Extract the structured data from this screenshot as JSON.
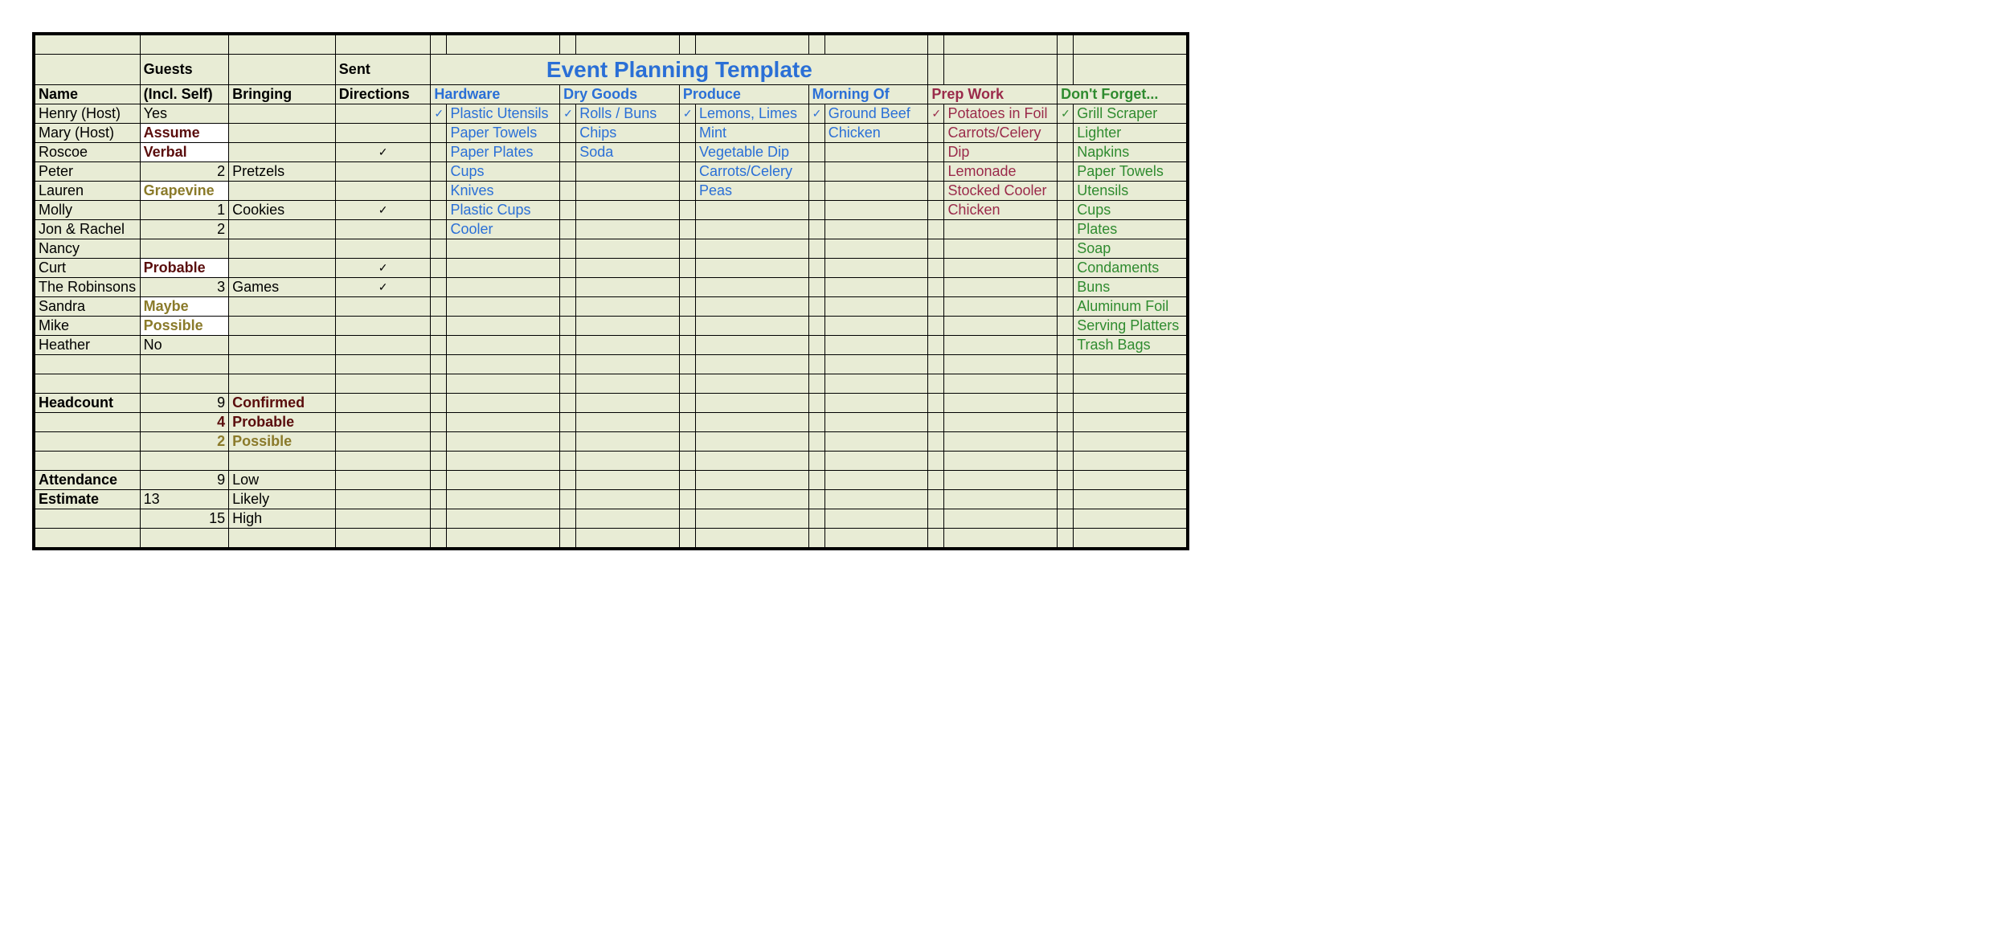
{
  "title": "Event Planning Template",
  "headers": {
    "guests": "Guests",
    "sent": "Sent",
    "name": "Name",
    "incl": "(Incl. Self)",
    "bringing": "Bringing",
    "directions": "Directions",
    "hardware": "Hardware",
    "drygoods": "Dry Goods",
    "produce": "Produce",
    "morning": "Morning Of",
    "prep": "Prep Work",
    "dontforget": "Don't Forget..."
  },
  "guests": [
    {
      "name": "Henry (Host)",
      "incl": "Yes",
      "bringing": "",
      "dir": ""
    },
    {
      "name": "Mary (Host)",
      "incl": "Assume",
      "inclClass": "txt-darkred white-bg",
      "bringing": "",
      "dir": ""
    },
    {
      "name": "Roscoe",
      "incl": "Verbal",
      "inclClass": "txt-darkred white-bg",
      "bringing": "",
      "dir": "✓"
    },
    {
      "name": "Peter",
      "incl": "2",
      "inclNum": true,
      "bringing": "Pretzels",
      "dir": ""
    },
    {
      "name": "Lauren",
      "incl": "Grapevine",
      "inclClass": "txt-olive white-bg",
      "bringing": "",
      "dir": ""
    },
    {
      "name": "Molly",
      "incl": "1",
      "inclNum": true,
      "bringing": "Cookies",
      "dir": "✓"
    },
    {
      "name": "Jon & Rachel",
      "incl": "2",
      "inclNum": true,
      "bringing": "",
      "dir": ""
    },
    {
      "name": "Nancy",
      "incl": "",
      "bringing": "",
      "dir": ""
    },
    {
      "name": "Curt",
      "incl": "Probable",
      "inclClass": "txt-darkred white-bg",
      "bringing": "",
      "dir": "✓"
    },
    {
      "name": "The Robinsons",
      "incl": "3",
      "inclNum": true,
      "bringing": "Games",
      "dir": "✓"
    },
    {
      "name": "Sandra",
      "incl": "Maybe",
      "inclClass": "txt-olive white-bg",
      "bringing": "",
      "dir": ""
    },
    {
      "name": "Mike",
      "incl": "Possible",
      "inclClass": "txt-olive white-bg",
      "bringing": "",
      "dir": ""
    },
    {
      "name": "Heather",
      "incl": "No",
      "bringing": "",
      "dir": ""
    }
  ],
  "hardware": [
    {
      "chk": "✓",
      "item": "Plastic Utensils"
    },
    {
      "chk": "",
      "item": "Paper Towels"
    },
    {
      "chk": "",
      "item": "Paper Plates"
    },
    {
      "chk": "",
      "item": "Cups"
    },
    {
      "chk": "",
      "item": "Knives"
    },
    {
      "chk": "",
      "item": "Plastic Cups"
    },
    {
      "chk": "",
      "item": "Cooler"
    }
  ],
  "drygoods": [
    {
      "chk": "✓",
      "item": "Rolls / Buns"
    },
    {
      "chk": "",
      "item": "Chips"
    },
    {
      "chk": "",
      "item": "Soda"
    }
  ],
  "produce": [
    {
      "chk": "✓",
      "item": "Lemons, Limes"
    },
    {
      "chk": "",
      "item": "Mint"
    },
    {
      "chk": "",
      "item": "Vegetable Dip"
    },
    {
      "chk": "",
      "item": "Carrots/Celery"
    },
    {
      "chk": "",
      "item": "Peas"
    }
  ],
  "morning": [
    {
      "chk": "✓",
      "item": "Ground Beef"
    },
    {
      "chk": "",
      "item": "Chicken"
    }
  ],
  "prep": [
    {
      "chk": "✓",
      "item": "Potatoes in Foil"
    },
    {
      "chk": "",
      "item": "Carrots/Celery"
    },
    {
      "chk": "",
      "item": "Dip"
    },
    {
      "chk": "",
      "item": "Lemonade"
    },
    {
      "chk": "",
      "item": "Stocked Cooler"
    },
    {
      "chk": "",
      "item": "Chicken"
    }
  ],
  "dontforget": [
    {
      "chk": "✓",
      "item": "Grill Scraper"
    },
    {
      "chk": "",
      "item": "Lighter"
    },
    {
      "chk": "",
      "item": "Napkins"
    },
    {
      "chk": "",
      "item": "Paper Towels"
    },
    {
      "chk": "",
      "item": "Utensils"
    },
    {
      "chk": "",
      "item": "Cups"
    },
    {
      "chk": "",
      "item": "Plates"
    },
    {
      "chk": "",
      "item": "Soap"
    },
    {
      "chk": "",
      "item": "Condaments"
    },
    {
      "chk": "",
      "item": "Buns"
    },
    {
      "chk": "",
      "item": "Aluminum Foil"
    },
    {
      "chk": "",
      "item": "Serving Platters"
    },
    {
      "chk": "",
      "item": "Trash Bags"
    }
  ],
  "summary": {
    "headcount_label": "Headcount",
    "headcount_val": "9",
    "confirmed": "Confirmed",
    "probable_val": "4",
    "probable": "Probable",
    "possible_val": "2",
    "possible": "Possible",
    "attendance_label": "Attendance",
    "attendance_val": "9",
    "low": "Low",
    "estimate_label": "Estimate",
    "estimate_val": "13",
    "likely": "Likely",
    "high_val": "15",
    "high": "High"
  }
}
